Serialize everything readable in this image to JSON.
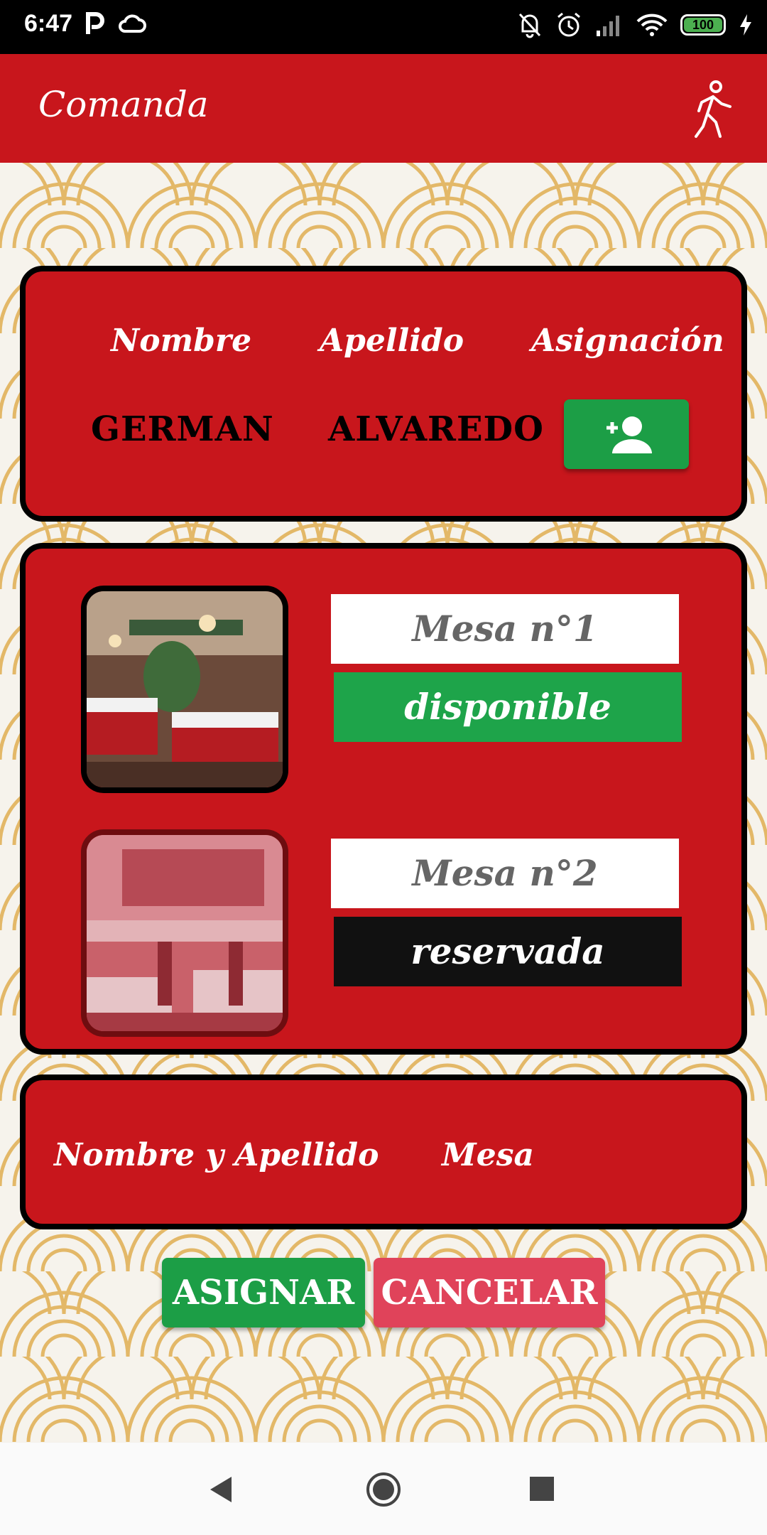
{
  "status_bar": {
    "time": "6:47",
    "battery": "100",
    "icons_left": [
      "parking-icon",
      "cloud-icon"
    ],
    "icons_right": [
      "bell-off-icon",
      "alarm-icon",
      "signal-icon",
      "wifi-icon",
      "battery-icon",
      "charging-icon"
    ]
  },
  "app_bar": {
    "title": "Comanda",
    "action_icon": "walking-person-icon"
  },
  "employee_card": {
    "headers": {
      "nombre": "Nombre",
      "apellido": "Apellido",
      "asignacion": "Asignación"
    },
    "nombre": "GERMAN",
    "apellido": "ALVAREDO",
    "add_icon": "add-person-icon"
  },
  "tables": [
    {
      "label": "Mesa n°1",
      "status": "disponible",
      "status_color": "#1ea44a"
    },
    {
      "label": "Mesa n°2",
      "status": "reservada",
      "status_color": "#111111"
    }
  ],
  "assignment_card": {
    "col_name": "Nombre y Apellido",
    "col_mesa": "Mesa"
  },
  "actions": {
    "asignar": "ASIGNAR",
    "cancelar": "CANCELAR"
  },
  "colors": {
    "brand_red": "#c8161c",
    "green": "#1c9e46",
    "cancel_pink": "#e0435a"
  }
}
